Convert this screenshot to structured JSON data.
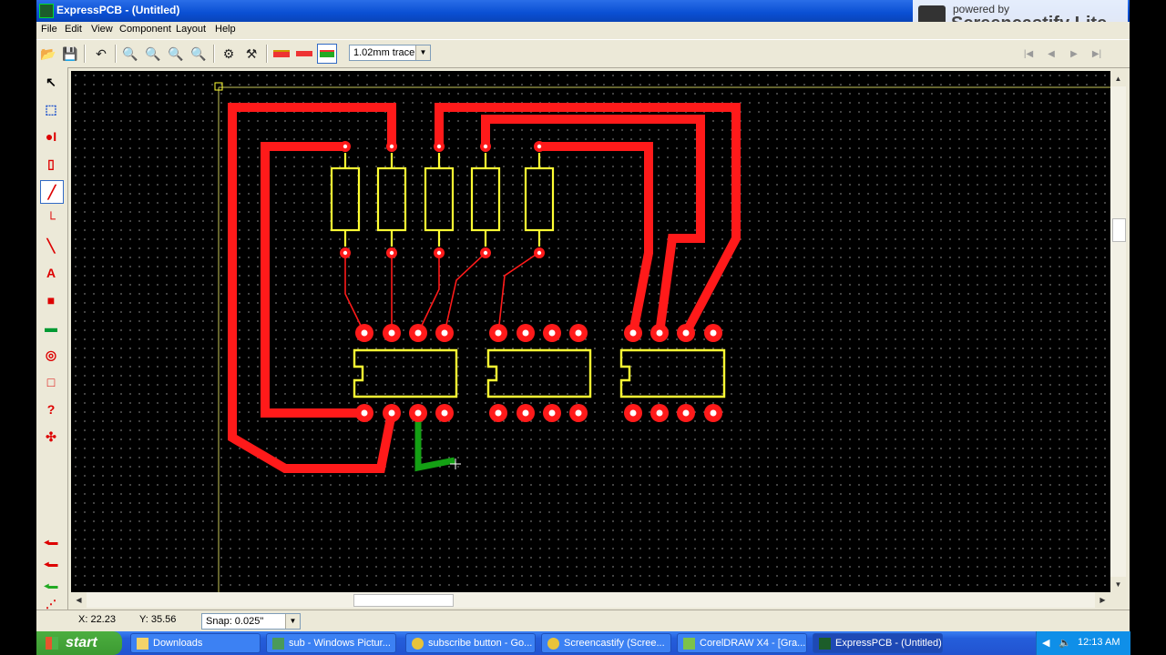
{
  "window": {
    "title": "ExpressPCB - (Untitled)",
    "min": "_",
    "max": "□",
    "close": "✕"
  },
  "menu": [
    "File",
    "Edit",
    "View",
    "Component",
    "Layout",
    "Help"
  ],
  "toolbar": {
    "trace_width": "1.02mm trace",
    "dropdown_arrow": "▼"
  },
  "status": {
    "x": "X: 22.23",
    "y": "Y: 35.56",
    "snap": "Snap: 0.025\"",
    "dropdown_arrow": "▼"
  },
  "watermark": {
    "line1": "powered by",
    "line2": "Screencastify Lite"
  },
  "taskbar": {
    "start": "start",
    "items": [
      "Downloads",
      "sub - Windows Pictur...",
      "subscribe button - Go...",
      "Screencastify (Scree...",
      "CorelDRAW X4 - [Gra...",
      "ExpressPCB - (Untitled)"
    ],
    "clock": "12:13 AM"
  },
  "colors": {
    "trace": "#ff1a1a",
    "silkscreen": "#ffff33",
    "new_trace": "#14a014",
    "canvas": "#000000"
  },
  "icons": {
    "open": "open-folder-icon",
    "save": "save-disk-icon",
    "undo": "undo-arrow-icon",
    "zoom": "magnifier-icon",
    "select": "pointer-arrow-icon",
    "pad": "pad-icon",
    "component": "component-icon",
    "trace": "trace-line-icon",
    "text": "text-A-icon"
  }
}
